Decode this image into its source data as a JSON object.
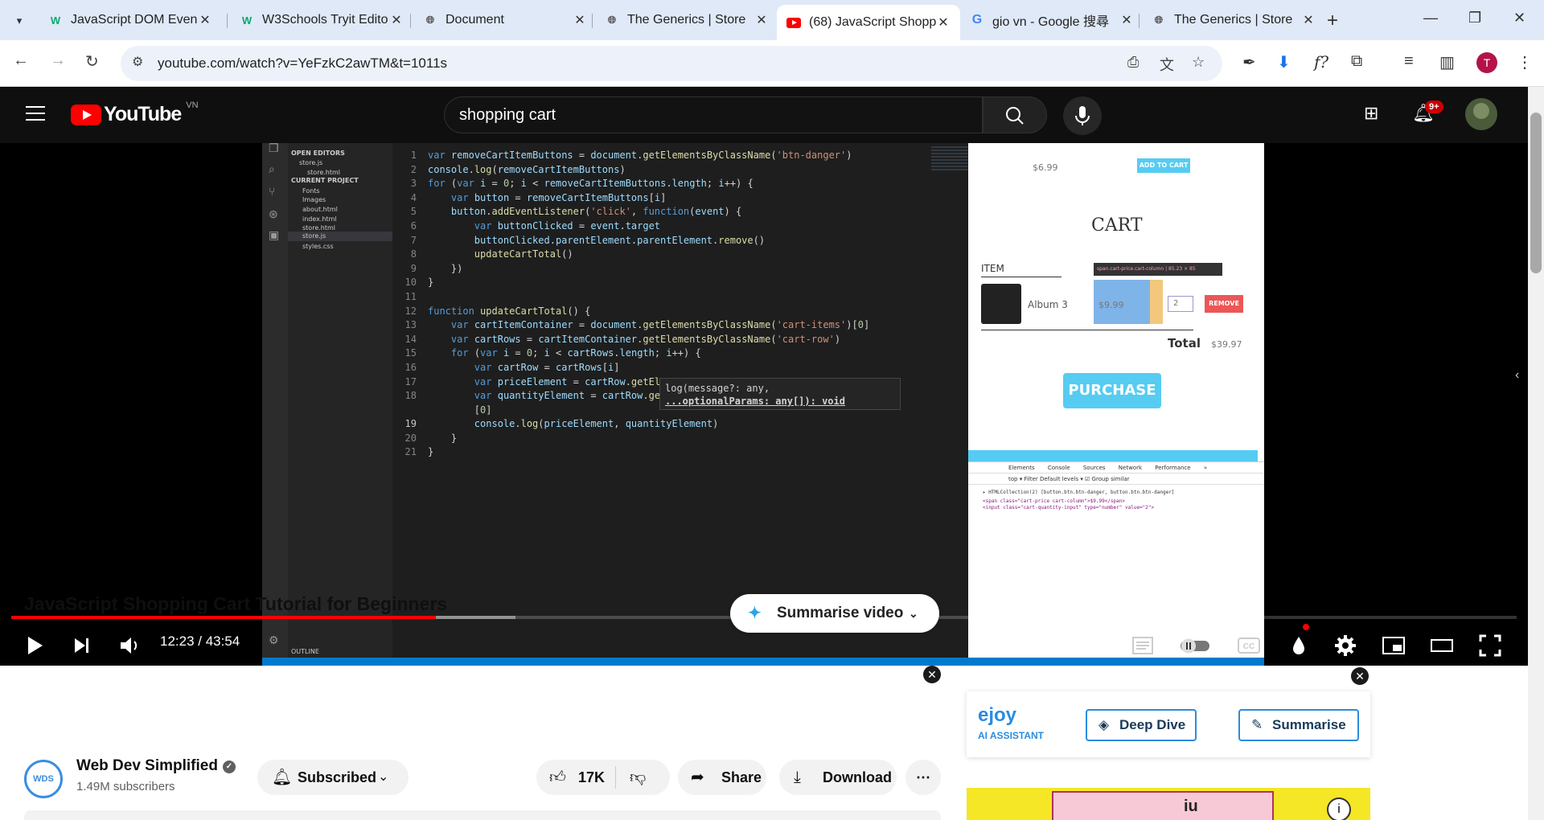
{
  "browser": {
    "tabs": [
      {
        "title": "JavaScript DOM Even",
        "favicon": "w3schools-icon",
        "active": false
      },
      {
        "title": "W3Schools Tryit Edito",
        "favicon": "w3schools-icon",
        "active": false
      },
      {
        "title": "Document",
        "favicon": "globe-icon",
        "active": false
      },
      {
        "title": "The Generics | Store",
        "favicon": "globe-icon",
        "active": false
      },
      {
        "title": "(68) JavaScript Shopp",
        "favicon": "youtube-icon",
        "active": true
      },
      {
        "title": "gio vn - Google 搜尋",
        "favicon": "google-icon",
        "active": false
      },
      {
        "title": "The Generics | Store",
        "favicon": "globe-icon",
        "active": false
      }
    ],
    "url": "youtube.com/watch?v=YeFzkC2awTM&t=1011s",
    "profile_initial": "T"
  },
  "youtube": {
    "logo_text": "YouTube",
    "country_code": "VN",
    "search_value": "shopping cart",
    "notifications_badge": "9+",
    "player": {
      "time": "12:23 / 43:54",
      "played_fraction": 0.282,
      "buffered_fraction": 0.335
    },
    "video_title": "JavaScript Shopping Cart Tutorial for Beginners",
    "summarise_video_label": "Summarise video",
    "channel": {
      "name": "Web Dev Simplified",
      "avatar_text": "WDS",
      "subscribers": "1.49M subscribers"
    },
    "subscribed_label": "Subscribed",
    "likes": "17K",
    "share_label": "Share",
    "download_label": "Download",
    "ejoy": {
      "logo": "ejoy",
      "subtitle": "AI ASSISTANT",
      "deep_dive_label": "Deep Dive",
      "summarise_label": "Summarise"
    },
    "ad_text": "iu"
  },
  "video_content": {
    "explorer": {
      "open_editors": "OPEN EDITORS",
      "open_files": [
        "store.js",
        "store.html"
      ],
      "current_project": "CURRENT PROJECT",
      "tree": [
        "Fonts",
        "Images",
        "about.html",
        "index.html",
        "store.html",
        "store.js",
        "styles.css"
      ],
      "outline": "OUTLINE"
    },
    "line_numbers": [
      "1",
      "2",
      "3",
      "4",
      "5",
      "6",
      "7",
      "8",
      "9",
      "10",
      "11",
      "12",
      "13",
      "14",
      "15",
      "16",
      "17",
      "18",
      "",
      "19",
      "20",
      "21"
    ],
    "hint_line1": "log(message?: any,",
    "hint_line2": "...optionalParams: any[]): void",
    "store": {
      "price_top": "$6.99",
      "add_to_cart": "ADD TO CART",
      "cart_heading": "CART",
      "item_header": "ITEM",
      "tooltip": "span.cart-price.cart-column | 85.23 × 85",
      "album": "Album 3",
      "item_price": "$9.99",
      "quantity": "2",
      "remove": "REMOVE",
      "total_label": "Total",
      "total_value": "$39.97",
      "purchase": "PURCHASE"
    },
    "devtools": {
      "tabs": "Elements Console Sources Network Performance »",
      "toolbar": "top ▾     Filter     Default levels ▾   ☑ Group similar",
      "log1": "▸ HTMLCollection(2) [button.btn.btn-danger, button.btn.btn-danger]",
      "log2": "<span class=\"cart-price cart-column\">$9.99</span>",
      "log3": "<input class=\"cart-quantity-input\" type=\"number\" value=\"2\">"
    }
  }
}
